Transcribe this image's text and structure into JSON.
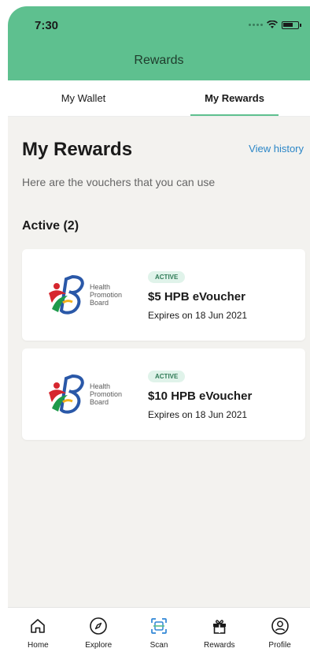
{
  "status_bar": {
    "time": "7:30"
  },
  "header": {
    "title": "Rewards"
  },
  "tabs": [
    {
      "label": "My Wallet",
      "active": false
    },
    {
      "label": "My Rewards",
      "active": true
    }
  ],
  "main": {
    "title": "My Rewards",
    "view_history": "View history",
    "subtitle": "Here are the vouchers that you can use",
    "section_title": "Active (2)"
  },
  "vouchers": [
    {
      "logo": {
        "line1": "Health",
        "line2": "Promotion",
        "line3": "Board"
      },
      "badge": "ACTIVE",
      "name": "$5 HPB eVoucher",
      "expiry": "Expires on 18 Jun 2021"
    },
    {
      "logo": {
        "line1": "Health",
        "line2": "Promotion",
        "line3": "Board"
      },
      "badge": "ACTIVE",
      "name": "$10 HPB eVoucher",
      "expiry": "Expires on 18 Jun 2021"
    }
  ],
  "bottom_nav": [
    {
      "label": "Home",
      "icon": "home-icon"
    },
    {
      "label": "Explore",
      "icon": "compass-icon"
    },
    {
      "label": "Scan",
      "icon": "scan-icon"
    },
    {
      "label": "Rewards",
      "icon": "gift-icon"
    },
    {
      "label": "Profile",
      "icon": "profile-icon"
    }
  ],
  "colors": {
    "brand_green": "#5ec08f",
    "link_blue": "#2b86c7",
    "background": "#f3f2ef",
    "badge_bg": "#e0f3ea",
    "badge_text": "#2f7a56"
  }
}
